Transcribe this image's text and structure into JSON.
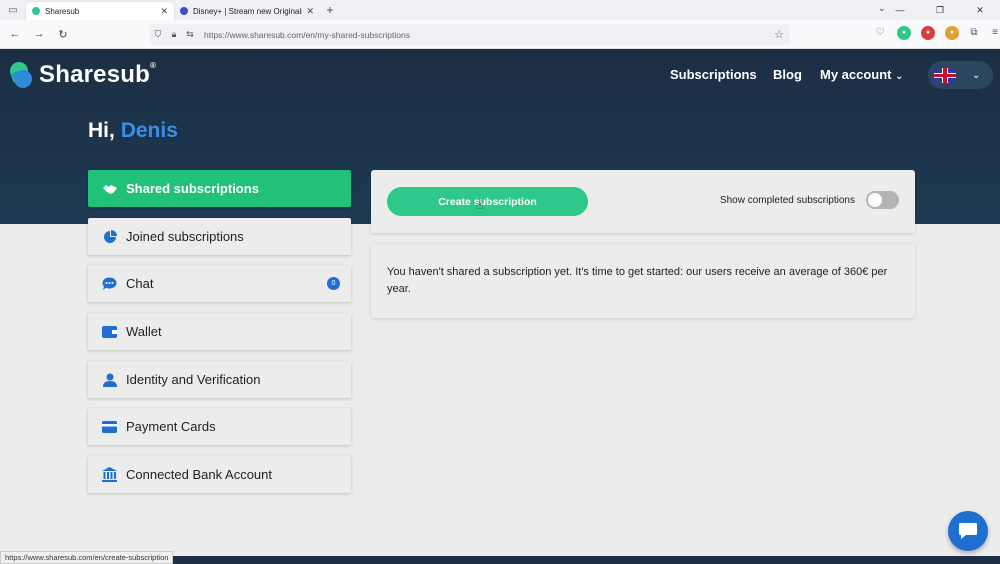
{
  "browser": {
    "tabs": [
      {
        "title": "Sharesub",
        "favicon_color": "#2dc88a",
        "active": true
      },
      {
        "title": "Disney+ | Stream new Originals",
        "favicon_color": "#3a4fd1",
        "active": false
      }
    ],
    "url": "https://www.sharesub.com/en/my-shared-subscriptions",
    "status_url": "https://www.sharesub.com/en/create-subscription"
  },
  "header": {
    "logo_text": "Sharesub",
    "nav": [
      "Subscriptions",
      "Blog",
      "My account"
    ],
    "language_icon": "uk-flag-icon"
  },
  "greeting": {
    "prefix": "Hi,",
    "name": "Denis"
  },
  "sidebar": {
    "items": [
      {
        "label": "Shared subscriptions",
        "icon": "handshake-icon",
        "active": true
      },
      {
        "label": "Joined subscriptions",
        "icon": "pie-chart-icon",
        "active": false
      },
      {
        "label": "Chat",
        "icon": "chat-icon",
        "active": false,
        "badge": "0"
      },
      {
        "label": "Wallet",
        "icon": "wallet-icon",
        "active": false
      },
      {
        "label": "Identity and Verification",
        "icon": "person-icon",
        "active": false
      },
      {
        "label": "Payment Cards",
        "icon": "credit-card-icon",
        "active": false
      },
      {
        "label": "Connected Bank Account",
        "icon": "bank-icon",
        "active": false
      }
    ]
  },
  "main": {
    "create_button": "Create subscription",
    "toggle_label": "Show completed subscriptions",
    "toggle_on": false,
    "empty_message": "You haven't shared a subscription yet. It's time to get started: our users receive an average of 360€ per year."
  },
  "colors": {
    "brand_green": "#21c17a",
    "brand_blue": "#1f6fd1",
    "hero_dark": "#1b2e44"
  }
}
